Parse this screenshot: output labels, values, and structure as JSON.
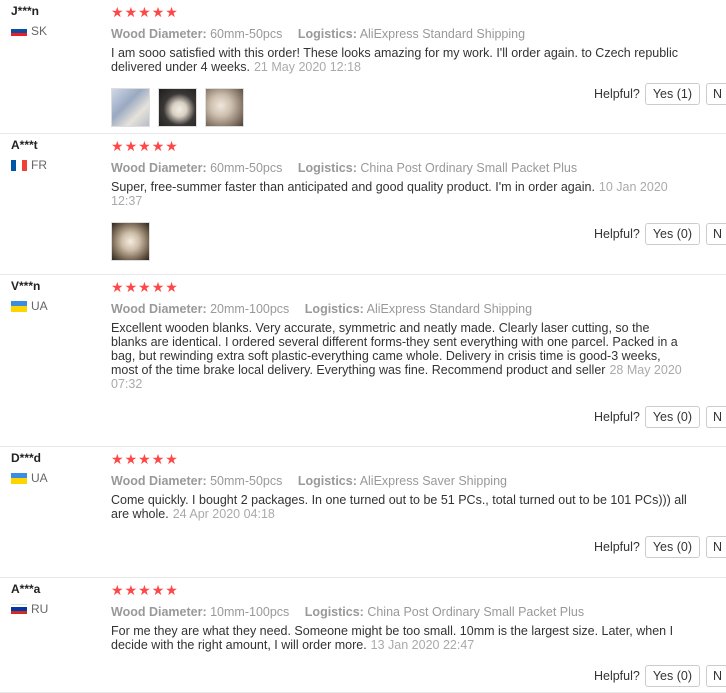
{
  "helpful_label": "Helpful?",
  "no_label": "N",
  "star_color": "#ff4747",
  "attr_labels": {
    "diameter": "Wood Diameter:",
    "logistics": "Logistics:"
  },
  "reviews": [
    {
      "user": "J***n",
      "country": "SK",
      "flag": "sk",
      "rating": 5,
      "diameter": "60mm-50pcs",
      "logistics": "AliExpress Standard Shipping",
      "text": "I am sooo satisfied with this order! These looks amazing for my work. I'll order again. to Czech republic delivered under 4 weeks.",
      "date": "21 May 2020 12:18",
      "photos": [
        "photo-1",
        "photo-2",
        "photo-3"
      ],
      "yes_label": "Yes (1)"
    },
    {
      "user": "A***t",
      "country": "FR",
      "flag": "fr",
      "rating": 5,
      "diameter": "60mm-50pcs",
      "logistics": "China Post Ordinary Small Packet Plus",
      "text": "Super, free-summer faster than anticipated and good quality product. I'm in order again.",
      "date": "10 Jan 2020 12:37",
      "photos": [
        "photo-1"
      ],
      "yes_label": "Yes (0)"
    },
    {
      "user": "V***n",
      "country": "UA",
      "flag": "ua",
      "rating": 5,
      "diameter": "20mm-100pcs",
      "logistics": "AliExpress Standard Shipping",
      "text": "Excellent wooden blanks. Very accurate, symmetric and neatly made. Clearly laser cutting, so the blanks are identical. I ordered several different forms-they sent everything with one parcel. Packed in a bag, but rewinding extra soft plastic-everything came whole. Delivery in crisis time is good-3 weeks, most of the time brake local delivery. Everything was fine. Recommend product and seller",
      "date": "28 May 2020 07:32",
      "photos": [],
      "yes_label": "Yes (0)"
    },
    {
      "user": "D***d",
      "country": "UA",
      "flag": "ua",
      "rating": 5,
      "diameter": "50mm-50pcs",
      "logistics": "AliExpress Saver Shipping",
      "text": "Come quickly. I bought 2 packages. In one turned out to be 51 PCs., total turned out to be 101 PCs))) all are whole.",
      "date": "24 Apr 2020 04:18",
      "photos": [],
      "yes_label": "Yes (0)"
    },
    {
      "user": "A***a",
      "country": "RU",
      "flag": "ru",
      "rating": 5,
      "diameter": "10mm-100pcs",
      "logistics": "China Post Ordinary Small Packet Plus",
      "text": "For me they are what they need. Someone might be too small. 10mm is the largest size. Later, when I decide with the right amount, I will order more.",
      "date": "13 Jan 2020 22:47",
      "photos": [],
      "yes_label": "Yes (0)"
    }
  ]
}
